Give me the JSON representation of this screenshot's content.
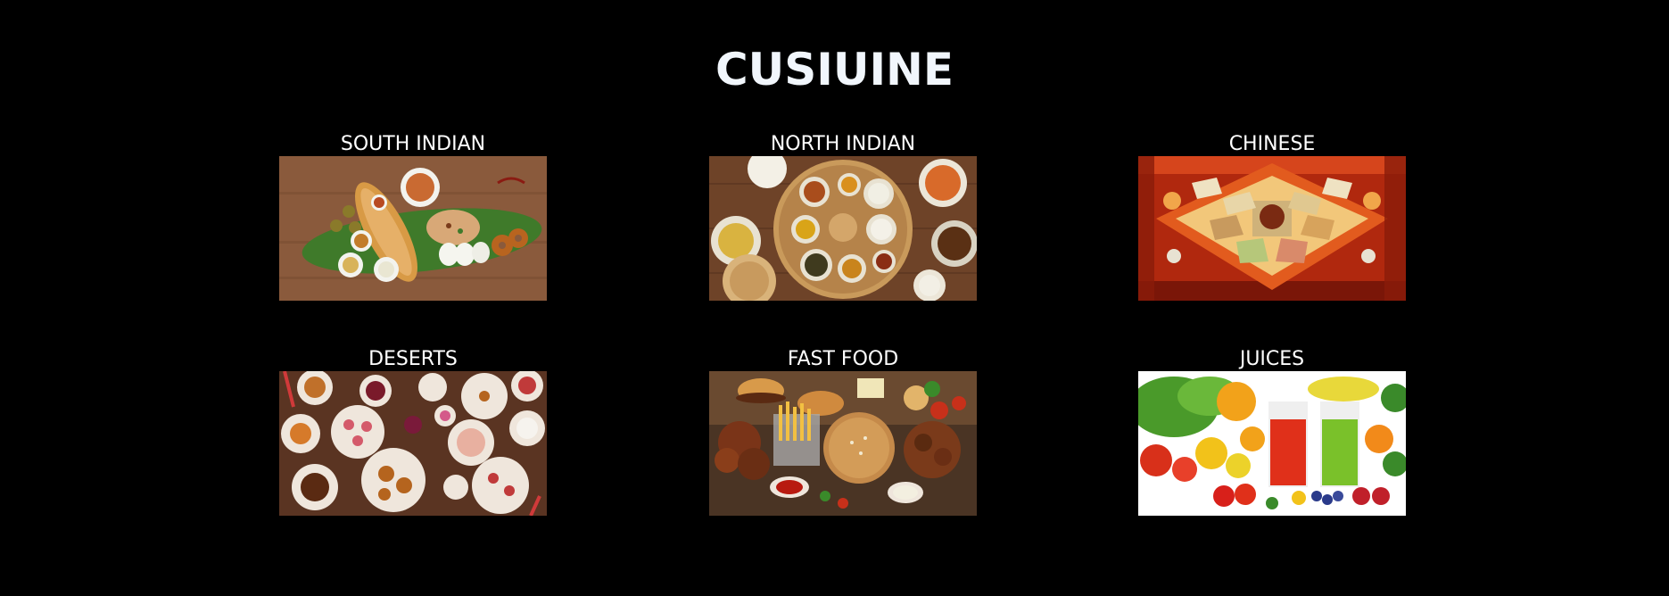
{
  "page": {
    "title": "CUSIUINE"
  },
  "cuisines": [
    {
      "label": "SOUTH INDIAN",
      "image": "south-indian-thali-photo"
    },
    {
      "label": "NORTH INDIAN",
      "image": "north-indian-thali-photo"
    },
    {
      "label": "CHINESE",
      "image": "chinese-hotpot-photo"
    },
    {
      "label": "DESERTS",
      "image": "desserts-platter-photo"
    },
    {
      "label": "FAST FOOD",
      "image": "fast-food-spread-photo"
    },
    {
      "label": "JUICES",
      "image": "fruit-juices-photo"
    }
  ],
  "colors": {
    "background": "#000000",
    "title": "#f1f6fc",
    "label": "#ffffff"
  }
}
